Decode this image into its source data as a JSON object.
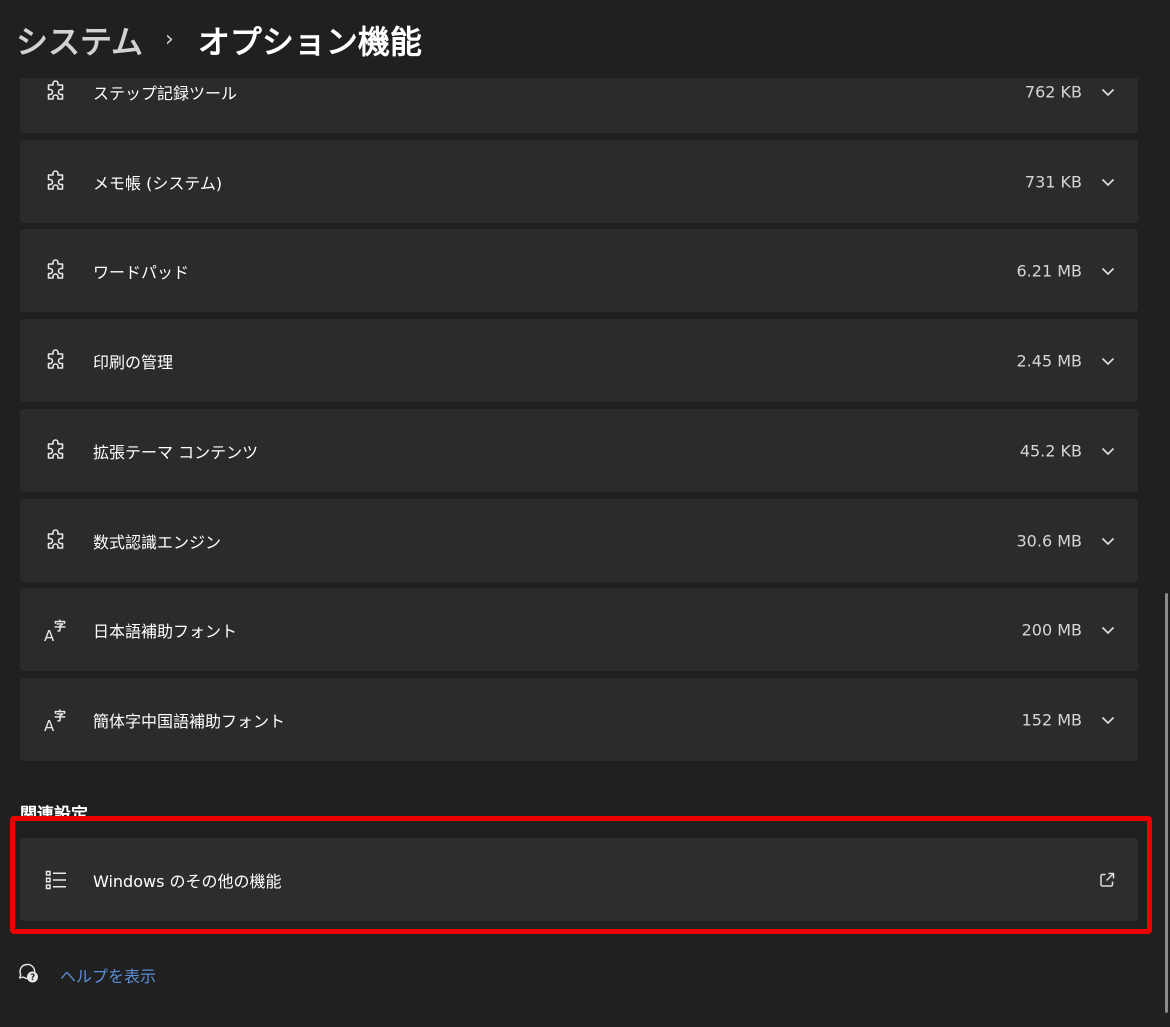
{
  "breadcrumb": {
    "parent": "システム",
    "separator": "›",
    "current": "オプション機能"
  },
  "features": [
    {
      "label": "ステップ記録ツール",
      "size": "762 KB",
      "icon": "puzzle-icon"
    },
    {
      "label": "メモ帳 (システム)",
      "size": "731 KB",
      "icon": "puzzle-icon"
    },
    {
      "label": "ワードパッド",
      "size": "6.21 MB",
      "icon": "puzzle-icon"
    },
    {
      "label": "印刷の管理",
      "size": "2.45 MB",
      "icon": "puzzle-icon"
    },
    {
      "label": "拡張テーマ コンテンツ",
      "size": "45.2 KB",
      "icon": "puzzle-icon"
    },
    {
      "label": "数式認識エンジン",
      "size": "30.6 MB",
      "icon": "puzzle-icon"
    },
    {
      "label": "日本語補助フォント",
      "size": "200 MB",
      "icon": "font-icon"
    },
    {
      "label": "簡体字中国語補助フォント",
      "size": "152 MB",
      "icon": "font-icon"
    }
  ],
  "related": {
    "heading": "関連設定",
    "item_label": "Windows のその他の機能",
    "item_icon": "list-icon",
    "action_icon": "open-external-icon"
  },
  "help": {
    "label": "ヘルプを表示",
    "icon": "help-icon"
  },
  "colors": {
    "background": "#202020",
    "card": "#2b2b2b",
    "highlight": "#ee0000",
    "link": "#5b8ed6"
  }
}
